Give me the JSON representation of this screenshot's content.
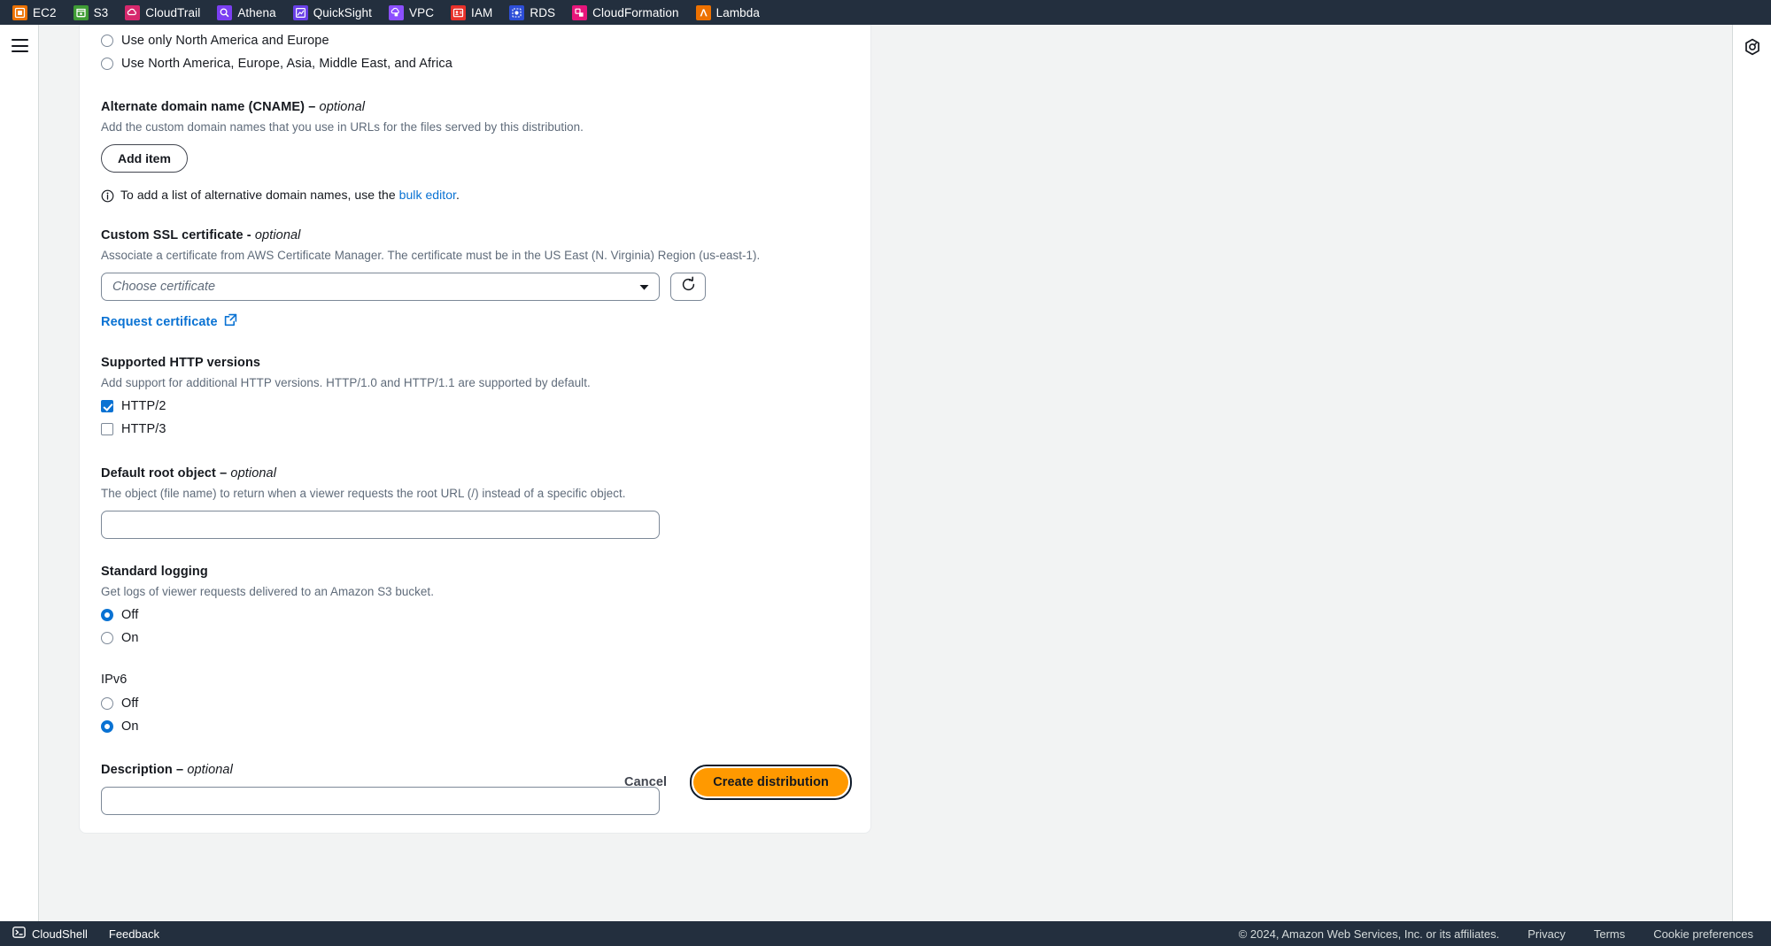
{
  "topbar": {
    "services": [
      {
        "name": "EC2",
        "color": "#ed7100",
        "icon": "ec2-icon"
      },
      {
        "name": "S3",
        "color": "#3f9c35",
        "icon": "s3-icon"
      },
      {
        "name": "CloudTrail",
        "color": "#d6286d",
        "icon": "cloudtrail-icon"
      },
      {
        "name": "Athena",
        "color": "#7b3ff2",
        "icon": "athena-icon"
      },
      {
        "name": "QuickSight",
        "color": "#6a40e8",
        "icon": "quicksight-icon"
      },
      {
        "name": "VPC",
        "color": "#8c4fff",
        "icon": "vpc-icon"
      },
      {
        "name": "IAM",
        "color": "#e8312a",
        "icon": "iam-icon"
      },
      {
        "name": "RDS",
        "color": "#2d4ed8",
        "icon": "rds-icon"
      },
      {
        "name": "CloudFormation",
        "color": "#e7157b",
        "icon": "cloudformation-icon"
      },
      {
        "name": "Lambda",
        "color": "#ed7100",
        "icon": "lambda-icon"
      }
    ]
  },
  "rails": {
    "menu_icon": "hamburger-menu-icon",
    "help_icon": "cloudfront-panel-icon"
  },
  "form": {
    "price_class": {
      "options": [
        {
          "label": "Use only North America and Europe",
          "selected": false
        },
        {
          "label": "Use North America, Europe, Asia, Middle East, and Africa",
          "selected": false
        }
      ]
    },
    "cname": {
      "label": "Alternate domain name (CNAME) –",
      "optional": "optional",
      "description": "Add the custom domain names that you use in URLs for the files served by this distribution.",
      "add_item_label": "Add item",
      "info_prefix": "To add a list of alternative domain names, use the ",
      "info_link": "bulk editor",
      "info_suffix": "."
    },
    "ssl": {
      "label": "Custom SSL certificate -",
      "optional": "optional",
      "description": "Associate a certificate from AWS Certificate Manager. The certificate must be in the US East (N. Virginia) Region (us-east-1).",
      "select_placeholder": "Choose certificate",
      "select_value": "",
      "refresh_icon": "refresh-icon",
      "caret_icon": "chevron-down-icon",
      "request_link": "Request certificate",
      "external_icon": "external-link-icon"
    },
    "http_versions": {
      "label": "Supported HTTP versions",
      "description": "Add support for additional HTTP versions. HTTP/1.0 and HTTP/1.1 are supported by default.",
      "options": [
        {
          "label": "HTTP/2",
          "checked": true
        },
        {
          "label": "HTTP/3",
          "checked": false
        }
      ]
    },
    "default_root_object": {
      "label": "Default root object –",
      "optional": "optional",
      "description": "The object (file name) to return when a viewer requests the root URL (/) instead of a specific object.",
      "value": "",
      "placeholder": ""
    },
    "standard_logging": {
      "label": "Standard logging",
      "description": "Get logs of viewer requests delivered to an Amazon S3 bucket.",
      "options": [
        {
          "label": "Off",
          "selected": true
        },
        {
          "label": "On",
          "selected": false
        }
      ]
    },
    "ipv6": {
      "label": "IPv6",
      "options": [
        {
          "label": "Off",
          "selected": false
        },
        {
          "label": "On",
          "selected": true
        }
      ]
    },
    "description_field": {
      "label": "Description –",
      "optional": "optional",
      "value": "",
      "placeholder": ""
    }
  },
  "actions": {
    "cancel_label": "Cancel",
    "create_label": "Create distribution"
  },
  "bottombar": {
    "cloudshell_label": "CloudShell",
    "cloudshell_icon": "cloudshell-terminal-icon",
    "feedback_label": "Feedback",
    "copyright": "© 2024, Amazon Web Services, Inc. or its affiliates.",
    "links": [
      "Privacy",
      "Terms",
      "Cookie preferences"
    ]
  },
  "colors": {
    "accent": "#0972d3",
    "primary_button": "#ff9900",
    "chrome": "#232f3e"
  }
}
